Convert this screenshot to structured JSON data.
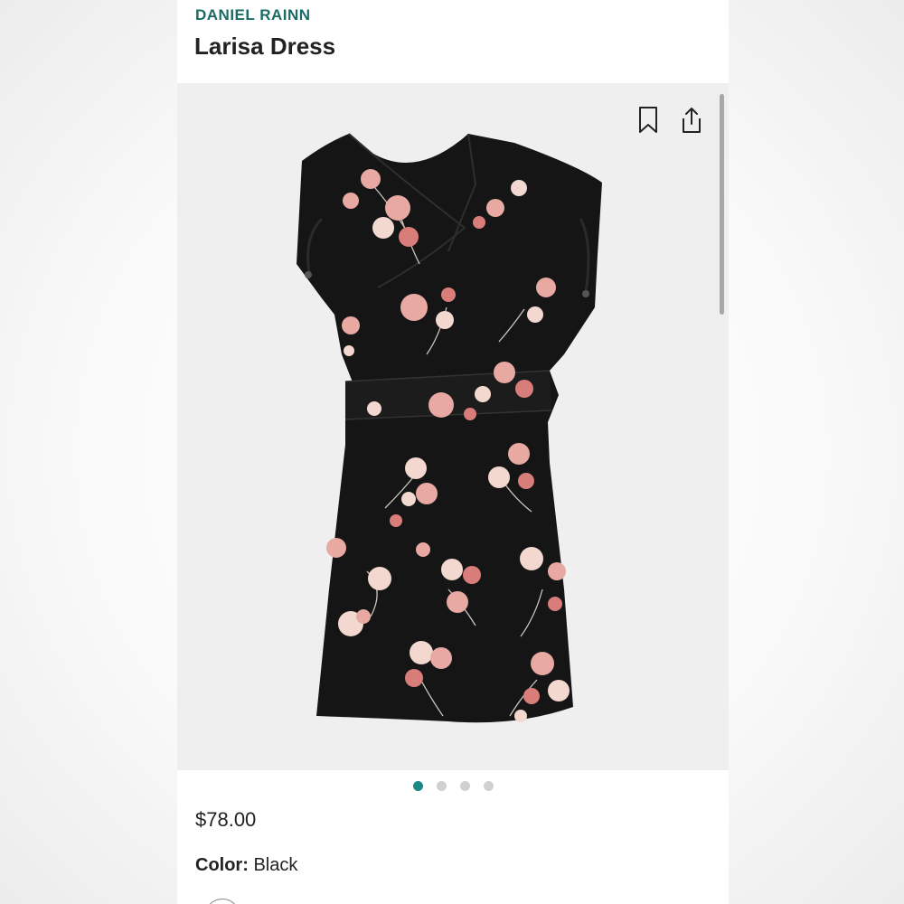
{
  "product": {
    "brand": "DANIEL RAINN",
    "title": "Larisa Dress",
    "price": "$78.00",
    "color_label": "Color:",
    "color_value": "Black"
  },
  "gallery": {
    "image_count": 4,
    "active_index": 0,
    "accent_color": "#1b8a88",
    "dress_color": "#151515",
    "floral_colors": [
      "#e8a9a3",
      "#f2d8cf",
      "#d97d7a"
    ]
  },
  "icons": {
    "bookmark": "bookmark-icon",
    "share": "share-icon"
  },
  "theme": {
    "brand_color": "#1a6b66",
    "text_color": "#222222",
    "gallery_bg": "#efeff0"
  }
}
